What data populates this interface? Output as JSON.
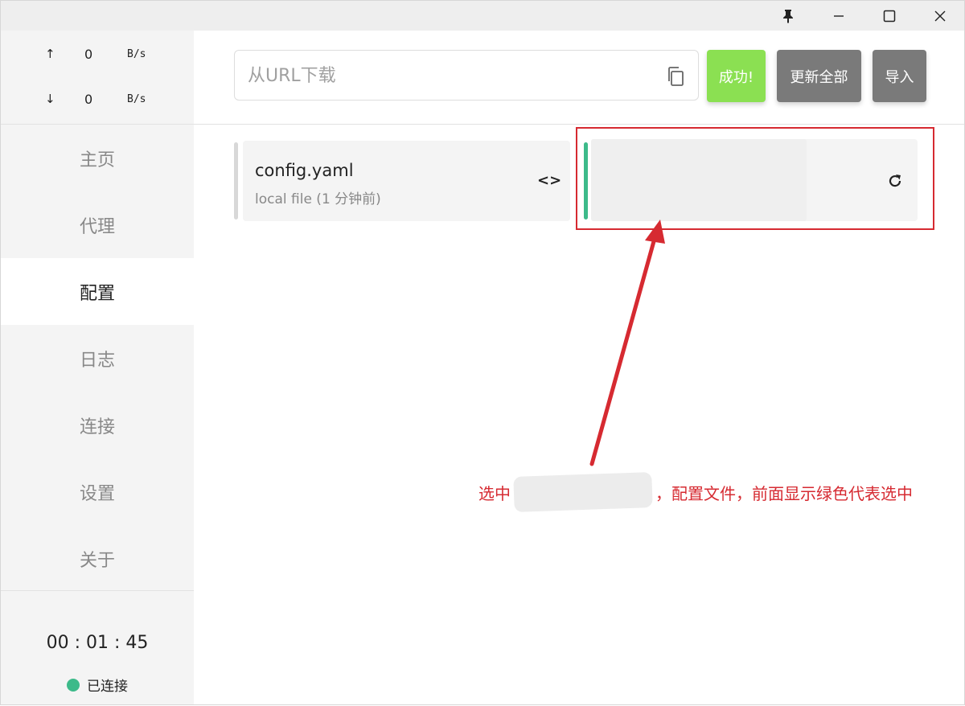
{
  "titlebar": {
    "buttons": [
      "pin-icon",
      "minimize-icon",
      "maximize-icon",
      "close-icon"
    ]
  },
  "traffic": {
    "up_arrow": "↑",
    "up_value": "0",
    "up_unit": "B/s",
    "down_arrow": "↓",
    "down_value": "0",
    "down_unit": "B/s"
  },
  "nav": {
    "items": [
      {
        "label": "主页"
      },
      {
        "label": "代理"
      },
      {
        "label": "配置"
      },
      {
        "label": "日志"
      },
      {
        "label": "连接"
      },
      {
        "label": "设置"
      },
      {
        "label": "关于"
      }
    ],
    "active": "配置"
  },
  "footer": {
    "timer": "00 : 01 : 45",
    "status_label": "已连接",
    "status_color": "#3dba8a"
  },
  "toolbar": {
    "url_placeholder": "从URL下载",
    "url_value": "",
    "success_label": "成功!",
    "update_all_label": "更新全部",
    "import_label": "导入",
    "success_color": "#8be052",
    "button_color": "#7a7a7a"
  },
  "profiles": [
    {
      "name": "config.yaml",
      "subtitle": "local file (1 分钟前)",
      "selected": false
    },
    {
      "name": "",
      "subtitle": "",
      "selected": true
    }
  ],
  "annotation": {
    "text_before": "选中",
    "text_after": "，配置文件，前面显示绿色代表选中",
    "color": "#d62a31"
  }
}
